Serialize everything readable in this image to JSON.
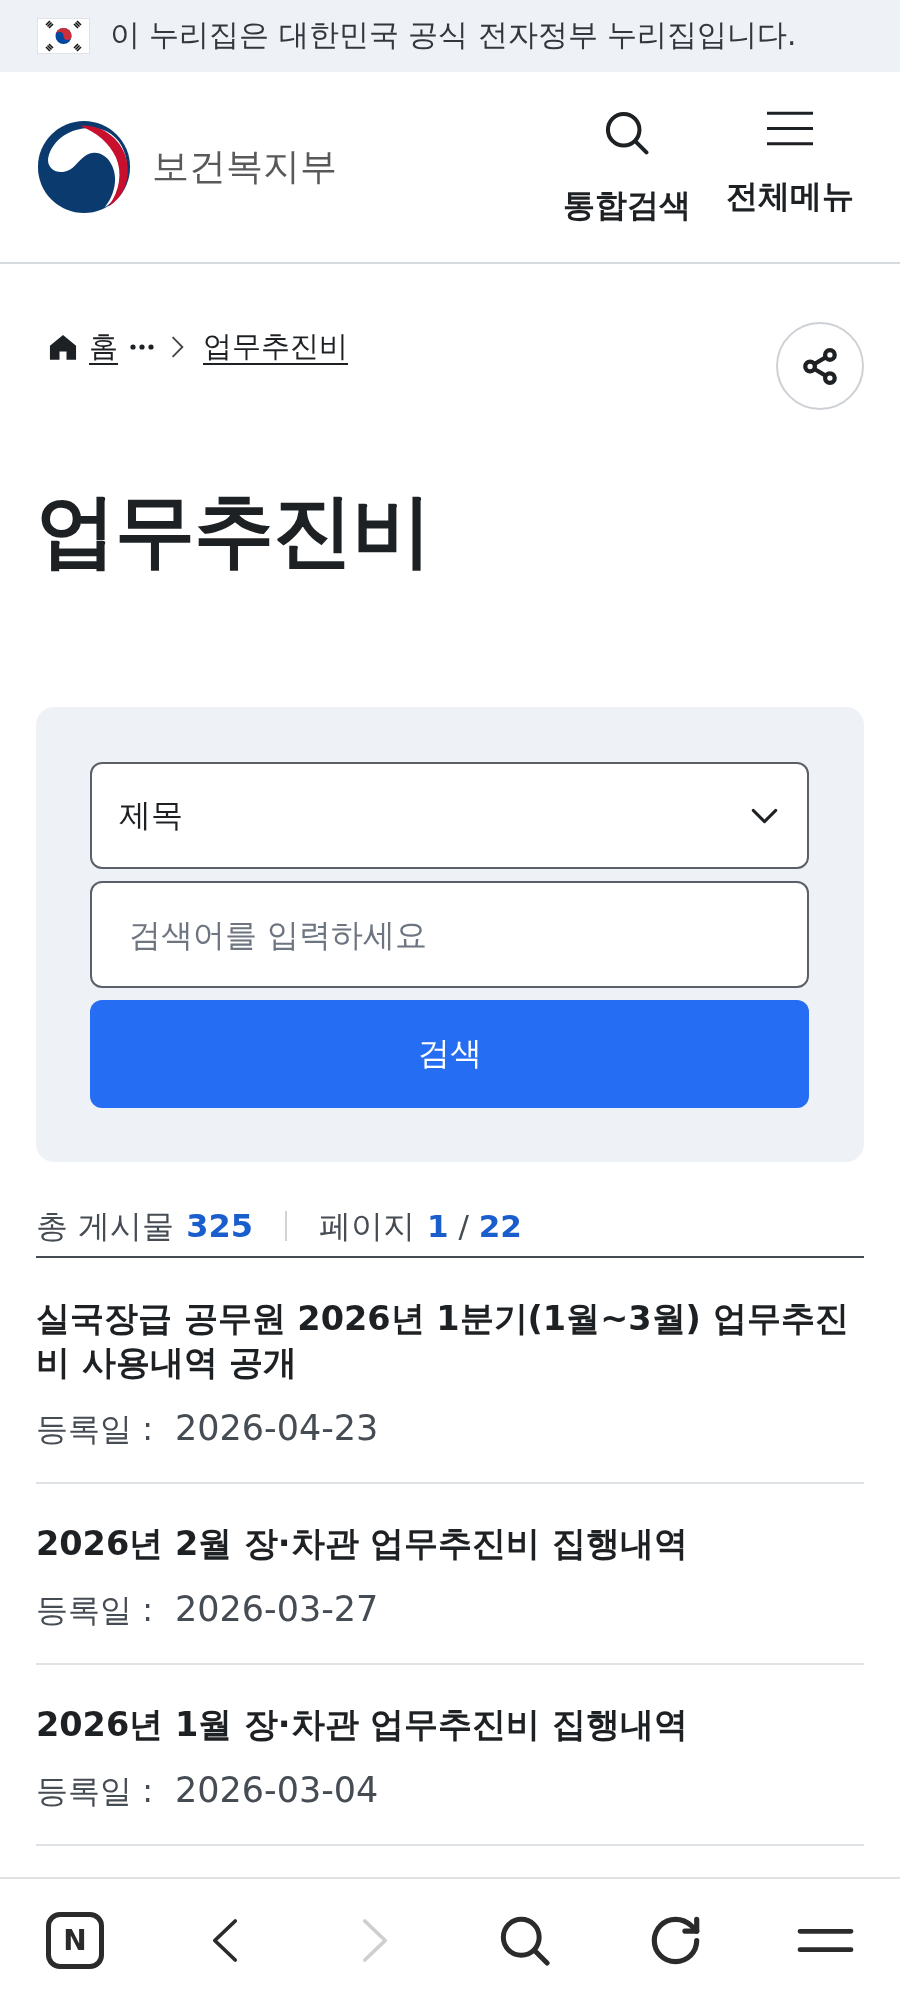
{
  "gov_banner": {
    "text": "이 누리집은 대한민국 공식 전자정부 누리집입니다."
  },
  "header": {
    "site_name": "보건복지부",
    "actions": [
      {
        "kind": "search",
        "label": "통합검색"
      },
      {
        "kind": "menu",
        "label": "전체메뉴"
      }
    ]
  },
  "breadcrumb": [
    {
      "kind": "home",
      "label": "홈"
    },
    {
      "kind": "more"
    },
    {
      "kind": "page",
      "label": "업무추진비"
    }
  ],
  "page_title": "업무추진비",
  "search_form": {
    "field": {
      "value": "제목"
    },
    "keyword": {
      "placeholder": "검색어를 입력하세요"
    },
    "submit": "검색"
  },
  "summary": {
    "total_label": "총 게시물",
    "total": "325",
    "page_label": "페이지",
    "page": "**1** / **22**"
  },
  "posts": [
    {
      "title": "실국장급 공무원 2026년 1분기(1월~3월) 업무추진비 사용내역 공개",
      "date_label": "등록일 :",
      "date": "2026-04-23"
    },
    {
      "title": "2026년 2월 장·차관 업무추진비 집행내역",
      "date_label": "등록일 :",
      "date": "2026-03-27"
    },
    {
      "title": "2026년 1월 장·차관 업무추진비 집행내역",
      "date_label": "등록일 :",
      "date": "2026-03-04"
    }
  ],
  "browser_bar": [
    {
      "kind": "logo",
      "label": "N",
      "disabled": false
    },
    {
      "kind": "back",
      "disabled": false
    },
    {
      "kind": "forward",
      "disabled": true
    },
    {
      "kind": "search",
      "disabled": false
    },
    {
      "kind": "reload",
      "disabled": false
    },
    {
      "kind": "menu",
      "disabled": false
    }
  ]
}
